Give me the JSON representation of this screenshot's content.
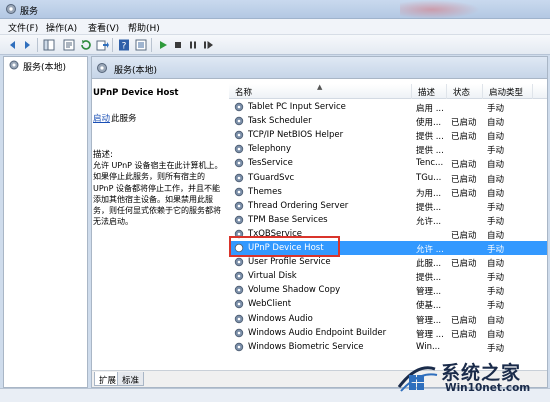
{
  "window": {
    "title": "服务"
  },
  "menu": {
    "items": [
      "文件(F)",
      "操作(A)",
      "查看(V)",
      "帮助(H)"
    ]
  },
  "tree": {
    "root_label": "服务(本地)"
  },
  "content_header": {
    "title": "服务(本地)"
  },
  "description_panel": {
    "service_name": "UPnP Device Host",
    "start_link": "启动",
    "start_suffix": "此服务",
    "desc_label": "描述:",
    "desc_text": "允许 UPnP 设备宿主在此计算机上。如果停止此服务，则所有宿主的 UPnP 设备都将停止工作，并且不能添加其他宿主设备。如果禁用此服务，则任何显式依赖于它的服务都将无法启动。"
  },
  "columns": {
    "name": "名称",
    "desc": "描述",
    "status": "状态",
    "startup": "启动类型"
  },
  "services": [
    {
      "name": "Tablet PC Input Service",
      "desc": "启用 ...",
      "status": "",
      "startup": "手动"
    },
    {
      "name": "Task Scheduler",
      "desc": "使用...",
      "status": "已启动",
      "startup": "自动"
    },
    {
      "name": "TCP/IP NetBIOS Helper",
      "desc": "提供 ...",
      "status": "已启动",
      "startup": "自动"
    },
    {
      "name": "Telephony",
      "desc": "提供 ...",
      "status": "",
      "startup": "手动"
    },
    {
      "name": "TesService",
      "desc": "Tenc...",
      "status": "已启动",
      "startup": "自动"
    },
    {
      "name": "TGuardSvc",
      "desc": "TGu...",
      "status": "已启动",
      "startup": "自动"
    },
    {
      "name": "Themes",
      "desc": "为用...",
      "status": "已启动",
      "startup": "自动"
    },
    {
      "name": "Thread Ordering Server",
      "desc": "提供...",
      "status": "",
      "startup": "手动"
    },
    {
      "name": "TPM Base Services",
      "desc": "允许...",
      "status": "",
      "startup": "手动"
    },
    {
      "name": "TxQBService",
      "desc": "",
      "status": "已启动",
      "startup": "自动"
    },
    {
      "name": "UPnP Device Host",
      "desc": "允许 ...",
      "status": "",
      "startup": "手动"
    },
    {
      "name": "User Profile Service",
      "desc": "此服...",
      "status": "已启动",
      "startup": "自动"
    },
    {
      "name": "Virtual Disk",
      "desc": "提供...",
      "status": "",
      "startup": "手动"
    },
    {
      "name": "Volume Shadow Copy",
      "desc": "管理...",
      "status": "",
      "startup": "手动"
    },
    {
      "name": "WebClient",
      "desc": "使基...",
      "status": "",
      "startup": "手动"
    },
    {
      "name": "Windows Audio",
      "desc": "管理...",
      "status": "已启动",
      "startup": "自动"
    },
    {
      "name": "Windows Audio Endpoint Builder",
      "desc": "管理 ...",
      "status": "已启动",
      "startup": "自动"
    },
    {
      "name": "Windows Biometric Service",
      "desc": "Win...",
      "status": "",
      "startup": "手动"
    }
  ],
  "selected_service": "UPnP Device Host",
  "tabs": [
    "扩展",
    "标准"
  ],
  "watermark": {
    "cn": "系统之家",
    "url": "Win10net.com"
  },
  "colors": {
    "selection": "#3399ff",
    "highlight_box": "#d9342b",
    "link": "#1a4fb5"
  },
  "icons": [
    "services-icon",
    "back-icon",
    "forward-icon",
    "console-tree-icon",
    "refresh-icon",
    "export-icon",
    "help-icon",
    "properties-icon",
    "play-icon",
    "stop-icon",
    "pause-icon",
    "restart-icon",
    "gear-icon"
  ]
}
